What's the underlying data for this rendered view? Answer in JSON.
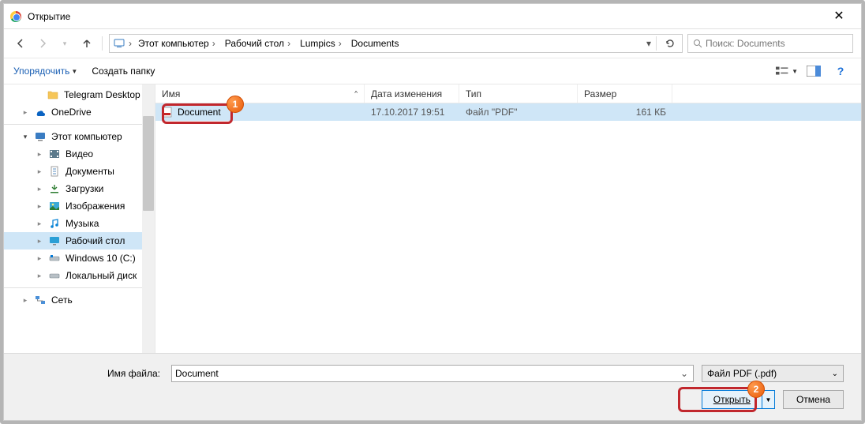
{
  "window": {
    "title": "Открытие"
  },
  "nav": {
    "breadcrumb_icon": "computer",
    "breadcrumb": [
      "Этот компьютер",
      "Рабочий стол",
      "Lumpics",
      "Documents"
    ]
  },
  "search": {
    "placeholder": "Поиск: Documents"
  },
  "toolbar": {
    "organize": "Упорядочить",
    "new_folder": "Создать папку"
  },
  "columns": {
    "name": "Имя",
    "modified": "Дата изменения",
    "type": "Тип",
    "size": "Размер"
  },
  "sidebar": {
    "items": [
      {
        "name": "Telegram Desktop",
        "icon": "folder",
        "level": 1
      },
      {
        "name": "OneDrive",
        "icon": "onedrive",
        "level": 0,
        "arrow": "▸"
      },
      {
        "sep": true
      },
      {
        "name": "Этот компьютер",
        "icon": "computer",
        "level": 0,
        "arrow": "▾"
      },
      {
        "name": "Видео",
        "icon": "video",
        "level": 1,
        "arrow": "▸"
      },
      {
        "name": "Документы",
        "icon": "doc",
        "level": 1,
        "arrow": "▸"
      },
      {
        "name": "Загрузки",
        "icon": "download",
        "level": 1,
        "arrow": "▸"
      },
      {
        "name": "Изображения",
        "icon": "image",
        "level": 1,
        "arrow": "▸"
      },
      {
        "name": "Музыка",
        "icon": "music",
        "level": 1,
        "arrow": "▸"
      },
      {
        "name": "Рабочий стол",
        "icon": "desktop",
        "level": 1,
        "arrow": "▸",
        "selected": true
      },
      {
        "name": "Windows 10 (C:)",
        "icon": "drive",
        "level": 1,
        "arrow": "▸"
      },
      {
        "name": "Локальный диск",
        "icon": "drive",
        "level": 1,
        "arrow": "▸"
      },
      {
        "sep": true
      },
      {
        "name": "Сеть",
        "icon": "network",
        "level": 0,
        "arrow": "▸"
      }
    ]
  },
  "files": {
    "list": [
      {
        "name": "Document",
        "date": "17.10.2017 19:51",
        "type": "Файл \"PDF\"",
        "size": "161 КБ"
      }
    ]
  },
  "filename_label": "Имя файла:",
  "filename_value": "Document",
  "filter_text": "Файл PDF (.pdf)",
  "open_label": "Открыть",
  "cancel_label": "Отмена",
  "callouts": {
    "one": "1",
    "two": "2"
  }
}
